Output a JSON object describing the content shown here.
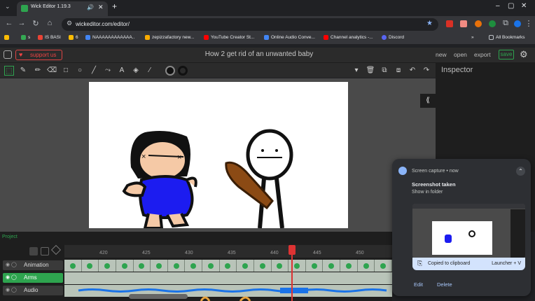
{
  "browser": {
    "tab_title": "Wick Editor 1.19.3",
    "url": "wickeditor.com/editor/",
    "bookmarks": [
      "s",
      "IS BASI",
      "6",
      "NAAAAAAAAAAAA..",
      "zepizzafactory new...",
      "YouTube Creator St...",
      "Online Audio Conve...",
      "Channel analytics -...",
      "Discord"
    ],
    "all_bookmarks": "All Bookmarks",
    "colors": {
      "frame": "#202124",
      "toolbar": "#35363a",
      "accent": "#8ab4f8"
    }
  },
  "editor": {
    "support_label": "support us",
    "project_title": "How 2 get rid of an unwanted baby",
    "menu": {
      "new": "new",
      "open": "open",
      "export": "export",
      "save": "save"
    },
    "inspector_label": "Inspector",
    "colors": {
      "accent": "#2ea44f",
      "danger": "#dd4444"
    }
  },
  "timeline": {
    "project_tab": "Project",
    "ticks": [
      "420",
      "425",
      "430",
      "435",
      "440",
      "445",
      "450"
    ],
    "layers": [
      {
        "name": "Animation",
        "selected": false
      },
      {
        "name": "Arms",
        "selected": true
      },
      {
        "name": "Audio",
        "selected": false
      }
    ]
  },
  "notification": {
    "app": "Screen capture • now",
    "title": "Screenshot taken",
    "subtitle": "Show in folder",
    "clipboard_label": "Copied to clipboard",
    "shortcut": "Launcher + V",
    "actions": {
      "edit": "Edit",
      "delete": "Delete"
    }
  }
}
